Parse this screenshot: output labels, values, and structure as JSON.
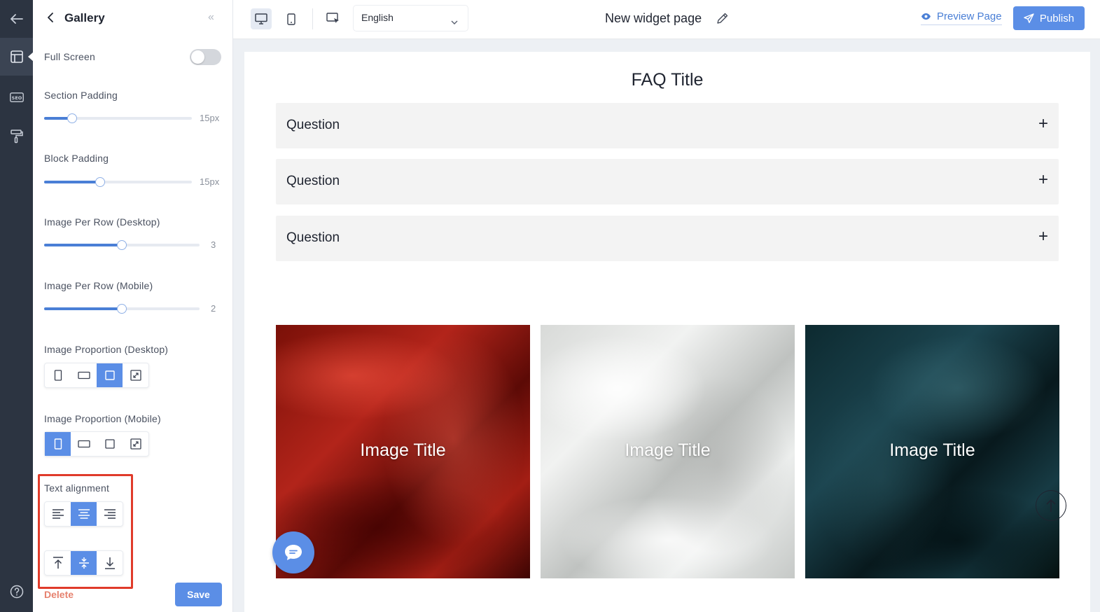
{
  "rail": {
    "items": [
      "back-arrow-icon",
      "layout-icon",
      "seo-icon",
      "paint-roller-icon",
      "help-icon"
    ],
    "seo_text": "SEO"
  },
  "panel": {
    "title": "Gallery",
    "collapse_glyph": "«",
    "full_screen": {
      "label": "Full Screen",
      "enabled": false
    },
    "section_padding": {
      "label": "Section Padding",
      "value": "15px",
      "fraction": 0.19
    },
    "block_padding": {
      "label": "Block Padding",
      "value": "15px",
      "fraction": 0.38
    },
    "image_per_row_desktop": {
      "label": "Image Per Row (Desktop)",
      "value": "3",
      "fraction": 0.5
    },
    "image_per_row_mobile": {
      "label": "Image Per Row (Mobile)",
      "value": "2",
      "fraction": 0.5
    },
    "image_proportion_desktop": {
      "label": "Image Proportion (Desktop)",
      "options": [
        "portrait",
        "landscape",
        "square",
        "original"
      ],
      "selected": "square"
    },
    "image_proportion_mobile": {
      "label": "Image Proportion (Mobile)",
      "options": [
        "portrait",
        "landscape",
        "square",
        "original"
      ],
      "selected": "portrait"
    },
    "text_alignment": {
      "label": "Text alignment",
      "horizontal_options": [
        "left",
        "center",
        "right"
      ],
      "horizontal_selected": "center",
      "vertical_options": [
        "top",
        "middle",
        "bottom"
      ],
      "vertical_selected": "middle"
    },
    "delete_label": "Delete",
    "save_label": "Save",
    "highlight_color": "#e03b2a"
  },
  "topbar": {
    "devices": [
      "desktop-icon",
      "mobile-icon"
    ],
    "active_device": "desktop",
    "language": "English",
    "page_title": "New widget page",
    "preview_label": "Preview Page",
    "publish_label": "Publish",
    "accent": "#5b8ee6"
  },
  "canvas": {
    "faq_title": "FAQ Title",
    "questions": [
      "Question",
      "Question",
      "Question"
    ],
    "plus_glyph": "+",
    "gallery": [
      {
        "title": "Image Title",
        "fabric": "red satin"
      },
      {
        "title": "Image Title",
        "fabric": "white satin"
      },
      {
        "title": "Image Title",
        "fabric": "dark teal satin"
      }
    ]
  }
}
